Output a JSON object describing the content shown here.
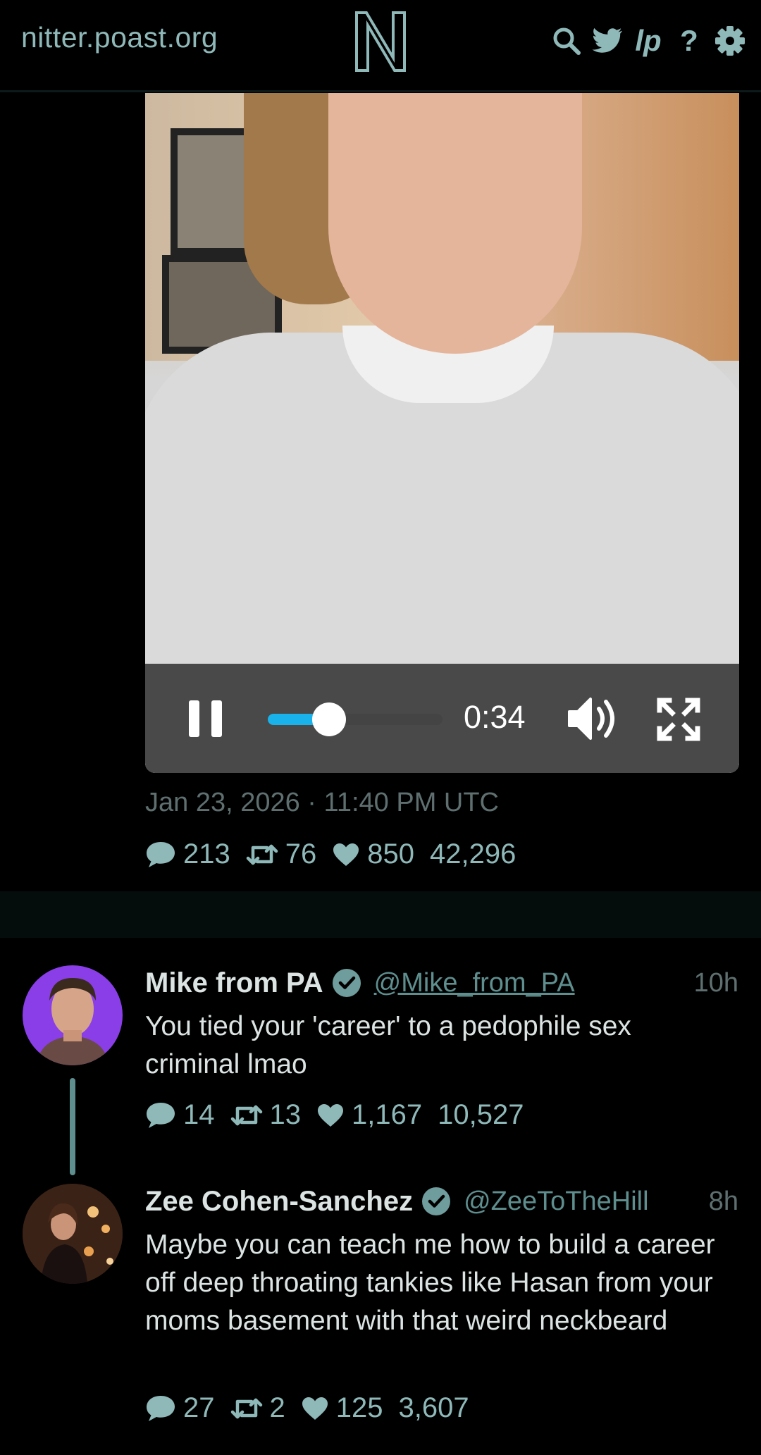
{
  "header": {
    "site_name": "nitter.poast.org",
    "logo_letter": "N",
    "icons": [
      "search-icon",
      "twitter-bird-icon",
      "lp-icon",
      "help-icon",
      "gear-icon"
    ],
    "lp_label": "lp",
    "help_label": "?"
  },
  "video": {
    "time": "0:34",
    "progress": 0.35,
    "state": "playing"
  },
  "main_tweet": {
    "date": "Jan 23, 2026 · 11:40 PM UTC",
    "replies": "213",
    "retweets": "76",
    "likes": "850",
    "views": "42,296"
  },
  "replies": [
    {
      "name": "Mike from PA",
      "handle": "@Mike_from_PA",
      "time": "10h",
      "text": "You tied your 'career' to a pedophile sex criminal lmao",
      "replies": "14",
      "retweets": "13",
      "likes": "1,167",
      "views": "10,527"
    },
    {
      "name": "Zee Cohen-Sanchez",
      "handle": "@ZeeToTheHill",
      "time": "8h",
      "text": "Maybe you can teach me how to build a career off deep throating tankies like Hasan from your moms basement with that weird neckbeard",
      "replies": "27",
      "retweets": "2",
      "likes": "125",
      "views": "3,607"
    }
  ],
  "colors": {
    "accent": "#8fb8b8",
    "progress": "#1ab2ea",
    "verified": "#6f9c9c",
    "avatar_bg_1": "#8a3ee8"
  }
}
